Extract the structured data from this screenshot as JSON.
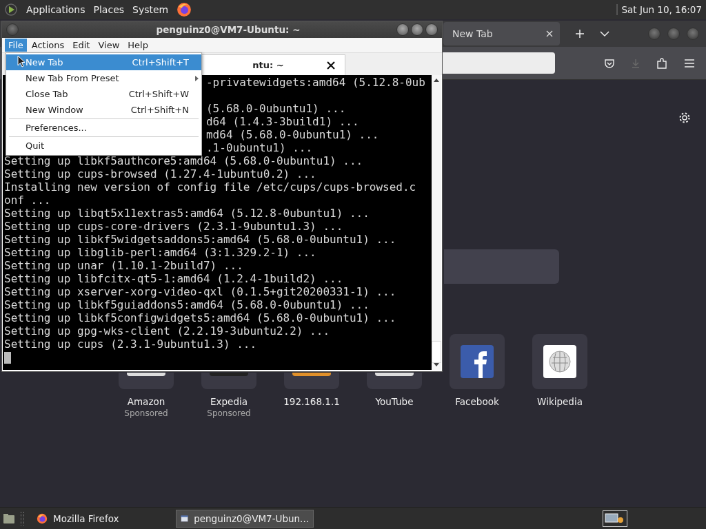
{
  "top_panel": {
    "menus": [
      "Applications",
      "Places",
      "System"
    ],
    "clock": "Sat Jun 10, 16:07"
  },
  "firefox": {
    "tabs": [
      {
        "label": "New Tab",
        "selected": true
      }
    ],
    "shortcuts": [
      {
        "label": "Amazon",
        "sublabel": "Sponsored",
        "kind": "grey"
      },
      {
        "label": "Expedia",
        "sublabel": "Sponsored",
        "kind": "dark"
      },
      {
        "label": "192.168.1.1",
        "kind": "orange"
      },
      {
        "label": "YouTube",
        "kind": "grey"
      },
      {
        "label": "Facebook",
        "kind": "f"
      },
      {
        "label": "Wikipedia",
        "kind": "globe"
      }
    ]
  },
  "terminal": {
    "title": "penguinz0@VM7-Ubuntu: ~",
    "menus": [
      {
        "label": "File",
        "selected": true
      },
      {
        "label": "Actions",
        "selected": false
      },
      {
        "label": "Edit",
        "selected": false
      },
      {
        "label": "View",
        "selected": false
      },
      {
        "label": "Help",
        "selected": false
      }
    ],
    "tab": {
      "label": "ntu: ~"
    },
    "lines": [
      {
        "text": "-privatewidgets:amd64 (5.12.8-0ub",
        "kind": "fragment"
      },
      {
        "kind": "blank"
      },
      {
        "text": "(5.68.0-0ubuntu1) ...",
        "kind": "fragment"
      },
      {
        "text": "d64 (1.4.3-3build1) ...",
        "kind": "fragment"
      },
      {
        "text": "md64 (5.68.0-0ubuntu1) ...",
        "kind": "fragment"
      },
      {
        "text": ".1-0ubuntu1) ...",
        "kind": "fragment"
      },
      {
        "text": "Setting up libkf5authcore5:amd64 (5.68.0-0ubuntu1) ...",
        "kind": "line"
      },
      {
        "text": "Setting up cups-browsed (1.27.4-1ubuntu0.2) ...",
        "kind": "line"
      },
      {
        "text": "Installing new version of config file /etc/cups/cups-browsed.c",
        "kind": "line"
      },
      {
        "text": "onf ...",
        "kind": "line"
      },
      {
        "text": "Setting up libqt5x11extras5:amd64 (5.12.8-0ubuntu1) ...",
        "kind": "line"
      },
      {
        "text": "Setting up cups-core-drivers (2.3.1-9ubuntu1.3) ...",
        "kind": "line"
      },
      {
        "text": "Setting up libkf5widgetsaddons5:amd64 (5.68.0-0ubuntu1) ...",
        "kind": "line"
      },
      {
        "text": "Setting up libglib-perl:amd64 (3:1.329.2-1) ...",
        "kind": "line"
      },
      {
        "text": "Setting up unar (1.10.1-2build7) ...",
        "kind": "line"
      },
      {
        "text": "Setting up libfcitx-qt5-1:amd64 (1.2.4-1build2) ...",
        "kind": "line"
      },
      {
        "text": "Setting up xserver-xorg-video-qxl (0.1.5+git20200331-1) ...",
        "kind": "line"
      },
      {
        "text": "Setting up libkf5guiaddons5:amd64 (5.68.0-0ubuntu1) ...",
        "kind": "line"
      },
      {
        "text": "Setting up libkf5configwidgets5:amd64 (5.68.0-0ubuntu1) ...",
        "kind": "line"
      },
      {
        "text": "Setting up gpg-wks-client (2.2.19-3ubuntu2.2) ...",
        "kind": "line"
      },
      {
        "text": "Setting up cups (2.3.1-9ubuntu1.3) ...",
        "kind": "line"
      }
    ],
    "file_menu": [
      {
        "kind": "item",
        "label": "New Tab",
        "shortcut": "Ctrl+Shift+T",
        "selected": true
      },
      {
        "kind": "submenu",
        "label": "New Tab From Preset",
        "selected": false
      },
      {
        "kind": "item",
        "label": "Close Tab",
        "shortcut": "Ctrl+Shift+W",
        "selected": false
      },
      {
        "kind": "item",
        "label": "New Window",
        "shortcut": "Ctrl+Shift+N",
        "selected": false
      },
      {
        "kind": "separator"
      },
      {
        "kind": "item",
        "label": "Preferences...",
        "selected": false
      },
      {
        "kind": "separator"
      },
      {
        "kind": "item",
        "label": "Quit",
        "selected": false
      }
    ]
  },
  "taskbar": {
    "tasks": [
      {
        "label": "Mozilla Firefox",
        "kind": "firefox",
        "selected": false
      },
      {
        "label": "penguinz0@VM7-Ubun...",
        "kind": "terminal",
        "selected": true
      }
    ]
  }
}
